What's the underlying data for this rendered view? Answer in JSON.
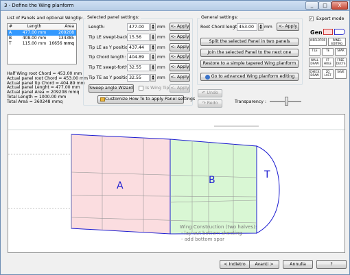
{
  "window": {
    "title": "3 - Define the Wing planform",
    "minimize": "_",
    "maximize": "□",
    "close": "X"
  },
  "panels_list": {
    "caption": "List of Panels and optional Wingtip:",
    "headers": [
      "#",
      "Length",
      "Area"
    ],
    "rows": [
      {
        "id": "A",
        "length": "477.00 mm",
        "area": "209208 mmq",
        "selected": true
      },
      {
        "id": "B",
        "length": "408.00 mm",
        "area": "134385 mmq",
        "selected": false
      },
      {
        "id": "T",
        "length": "115.00 mm",
        "area": "16656 mmq",
        "selected": false
      }
    ]
  },
  "stats": [
    "Half Wing root Chord = 453.00 mm",
    "Actual panel root Chord = 453.00 mm",
    "Actual panel tip Chord = 404.89 mm",
    "Actual panel Lenght = 477.00 mm",
    "Actual panel Area = 209208 mmq",
    "Total Length = 1000.00 mm",
    "Total Area = 360248 mmq"
  ],
  "panel_settings": {
    "title": "Selected panel settings:",
    "unit": "mm",
    "apply_label": "<- Apply",
    "fields": [
      {
        "label": "Length:",
        "value": "477.00"
      },
      {
        "label": "Tip LE swept-back:",
        "value": "15.56"
      },
      {
        "label": "Tip LE as Y position:",
        "value": "437.44"
      },
      {
        "label": "Tip Chord length:",
        "value": "404.89"
      },
      {
        "label": "Tip TE swept-forth:",
        "value": "32.55"
      },
      {
        "label": "Tip TE as Y position:",
        "value": "32.55"
      }
    ],
    "sweep_wizard": "Sweep angle Wizard",
    "is_wing_tip": "Is Wing Tip",
    "customize": "Customize How To to apply Panel settings"
  },
  "general_settings": {
    "title": "General settings:",
    "root_chord_label": "Root Chord length:",
    "root_chord_value": "453.00",
    "unit": "mm",
    "apply_label": "<- Apply",
    "split": "Split the selected Panel in two panels",
    "join": "Join the selected Panel to the next one",
    "restore": "Restore to a simple tapered Wing planform",
    "advanced": "Go to advanced Wing planform editing"
  },
  "undo_label": "Undo",
  "redo_label": "Redo",
  "transparency_label": "Transparency :",
  "expert_mode_label": "Expert mode",
  "icon_labels": [
    "Gen",
    "AIRFLOTOR",
    "PANEL EDITING",
    "T.LE",
    "TE",
    "SPAR",
    "WALL DRAW",
    "FF HOLE",
    "FREE DUCTS",
    "CHECK DRAW",
    "2D LAST",
    "SAVE"
  ],
  "canvas": {
    "labels": {
      "a": "A",
      "b": "B",
      "t": "T"
    },
    "notes": [
      "Wing Construction (two halves):",
      "- lay out bottom sheeting",
      "- add bottom spar"
    ],
    "colors": {
      "a": "#fbdde0",
      "b": "#d9f7d4",
      "t": "#ffffff",
      "outline": "#1c1cd0"
    }
  },
  "footer": {
    "back": "< Indietro",
    "next": "Avanti >",
    "cancel": "Annulla",
    "help": "?"
  }
}
